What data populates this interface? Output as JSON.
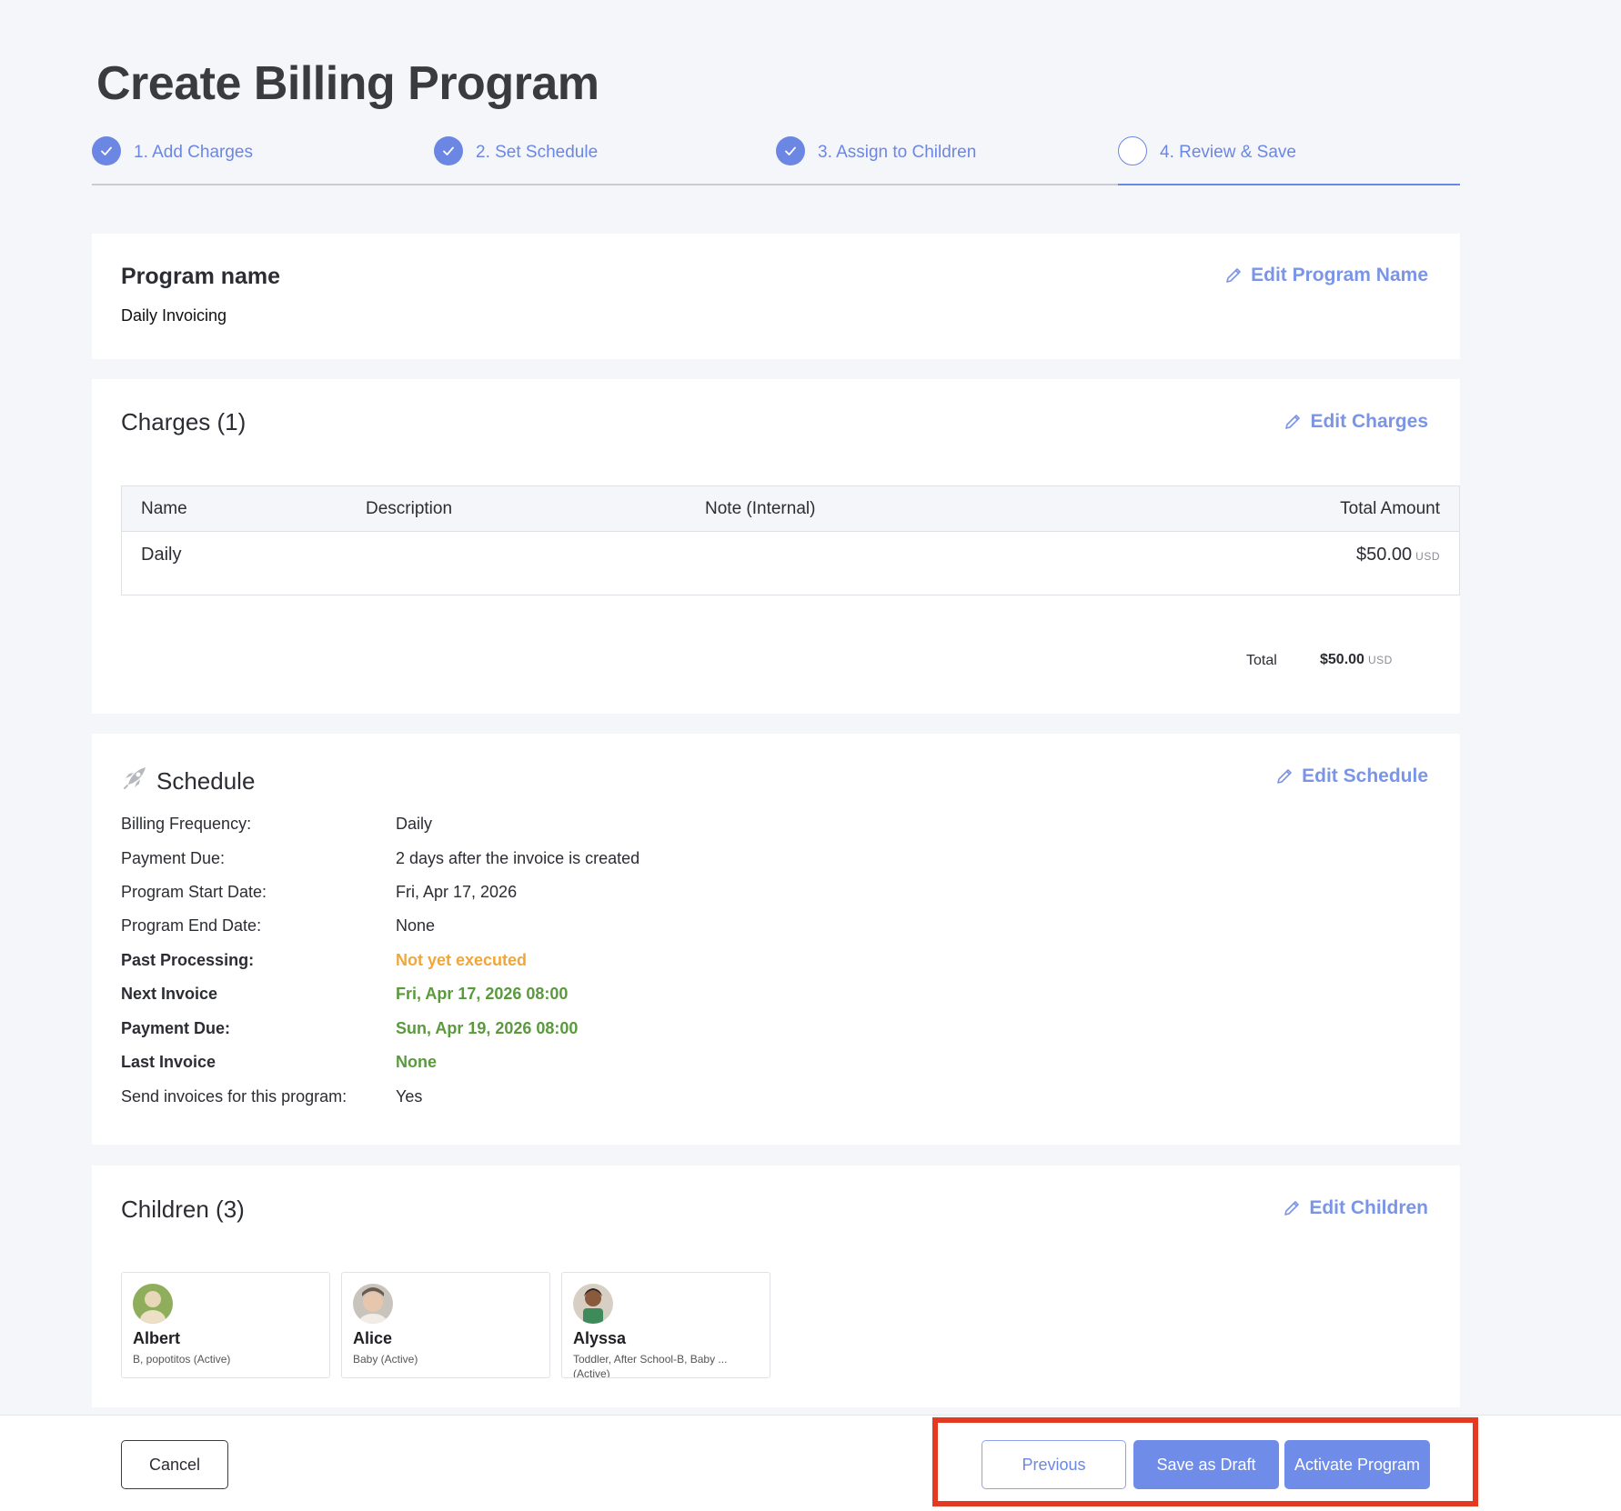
{
  "page": {
    "title": "Create Billing Program"
  },
  "steps": [
    {
      "label": "1. Add Charges",
      "status": "complete"
    },
    {
      "label": "2. Set Schedule",
      "status": "complete"
    },
    {
      "label": "3. Assign to Children",
      "status": "complete"
    },
    {
      "label": "4. Review & Save",
      "status": "current"
    }
  ],
  "program": {
    "heading": "Program name",
    "name": "Daily Invoicing",
    "edit_label": "Edit Program Name"
  },
  "charges": {
    "heading": "Charges (1)",
    "edit_label": "Edit Charges",
    "columns": [
      "Name",
      "Description",
      "Note (Internal)",
      "Total Amount"
    ],
    "rows": [
      {
        "name": "Daily",
        "description": "",
        "note": "",
        "amount": "$50.00",
        "currency": "USD"
      }
    ],
    "total_label": "Total",
    "total_amount": "$50.00",
    "total_currency": "USD"
  },
  "schedule": {
    "heading": "Schedule",
    "edit_label": "Edit Schedule",
    "rows": [
      {
        "label": "Billing Frequency:",
        "value": "Daily"
      },
      {
        "label": "Payment Due:",
        "value": "2 days after the invoice is created"
      },
      {
        "label": "Program Start Date:",
        "value": "Fri, Apr 17, 2026"
      },
      {
        "label": "Program End Date:",
        "value": "None"
      },
      {
        "label": "Past Processing:",
        "value": "Not yet executed"
      },
      {
        "label": "Next Invoice",
        "value": "Fri, Apr 17, 2026 08:00"
      },
      {
        "label": "Payment Due:",
        "value": "Sun, Apr 19, 2026 08:00"
      },
      {
        "label": "Last Invoice",
        "value": "None"
      },
      {
        "label": "Send invoices for this program:",
        "value": "Yes"
      }
    ]
  },
  "children": {
    "heading": "Children (3)",
    "edit_label": "Edit Children",
    "items": [
      {
        "name": "Albert",
        "detail": "B, popotitos (Active)"
      },
      {
        "name": "Alice",
        "detail": "Baby (Active)"
      },
      {
        "name": "Alyssa",
        "detail": "Toddler, After School-B, Baby ... (Active)"
      }
    ]
  },
  "footer": {
    "cancel_label": "Cancel",
    "previous_label": "Previous",
    "draft_label": "Save as Draft",
    "activate_label": "Activate Program"
  },
  "colors": {
    "accent": "#6b87e3",
    "warning": "#f0a63a",
    "success": "#5a9a3d",
    "highlight": "#e53a22"
  }
}
